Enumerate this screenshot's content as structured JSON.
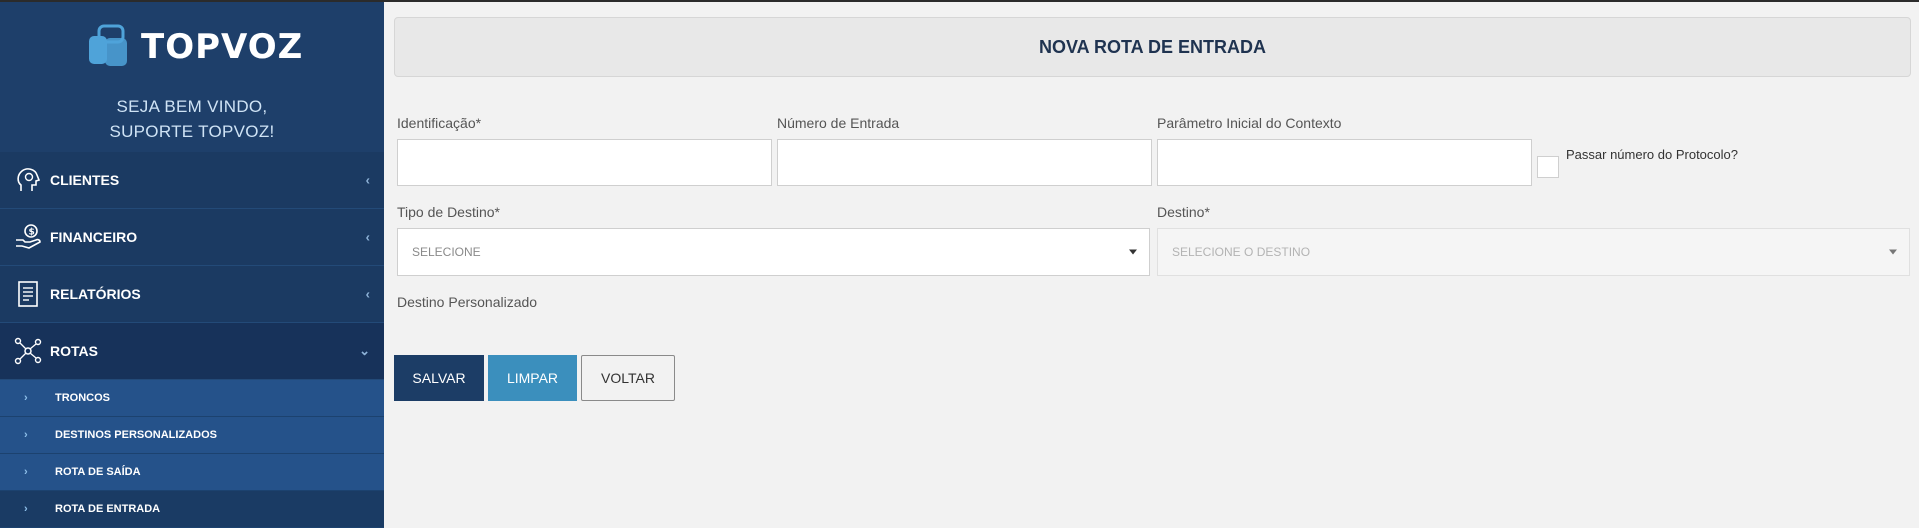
{
  "brand": {
    "logo_text": "TOPVOZ",
    "welcome_line1": "SEJA BEM VINDO,",
    "welcome_line2": "SUPORTE TOPVOZ!"
  },
  "sidebar": {
    "items": [
      {
        "label": "CLIENTES",
        "icon": "clients-head-gear-icon",
        "chevron": "‹"
      },
      {
        "label": "FINANCEIRO",
        "icon": "finance-hand-money-icon",
        "chevron": "‹"
      },
      {
        "label": "RELATÓRIOS",
        "icon": "reports-document-icon",
        "chevron": "‹"
      },
      {
        "label": "ROTAS",
        "icon": "routes-network-icon",
        "chevron": "⌄"
      }
    ],
    "sub_items": [
      {
        "label": "TRONCOS",
        "chevron": "›"
      },
      {
        "label": "DESTINOS PERSONALIZADOS",
        "chevron": "›"
      },
      {
        "label": "ROTA DE SAÍDA",
        "chevron": "›"
      },
      {
        "label": "ROTA DE ENTRADA",
        "chevron": "›"
      }
    ]
  },
  "page": {
    "title": "NOVA ROTA DE ENTRADA"
  },
  "form": {
    "identificacao_label": "Identificação*",
    "identificacao_value": "",
    "numero_label": "Número de Entrada",
    "numero_value": "",
    "parametro_label": "Parâmetro Inicial do Contexto",
    "parametro_value": "",
    "protocolo_label": "Passar número do Protocolo?",
    "protocolo_checked": false,
    "tipo_destino_label": "Tipo de Destino*",
    "tipo_destino_value": "SELECIONE",
    "destino_label": "Destino*",
    "destino_value": "SELECIONE O DESTINO",
    "destino_personalizado_label": "Destino Personalizado"
  },
  "buttons": {
    "save": "SALVAR",
    "clear": "LIMPAR",
    "back": "VOLTAR"
  },
  "colors": {
    "sidebar_bg": "#1e3f6a",
    "submenu_bg": "#25528a",
    "save_button": "#1c3d66",
    "clear_button": "#3b8fbd",
    "logo_accent": "#4fa3d9"
  }
}
